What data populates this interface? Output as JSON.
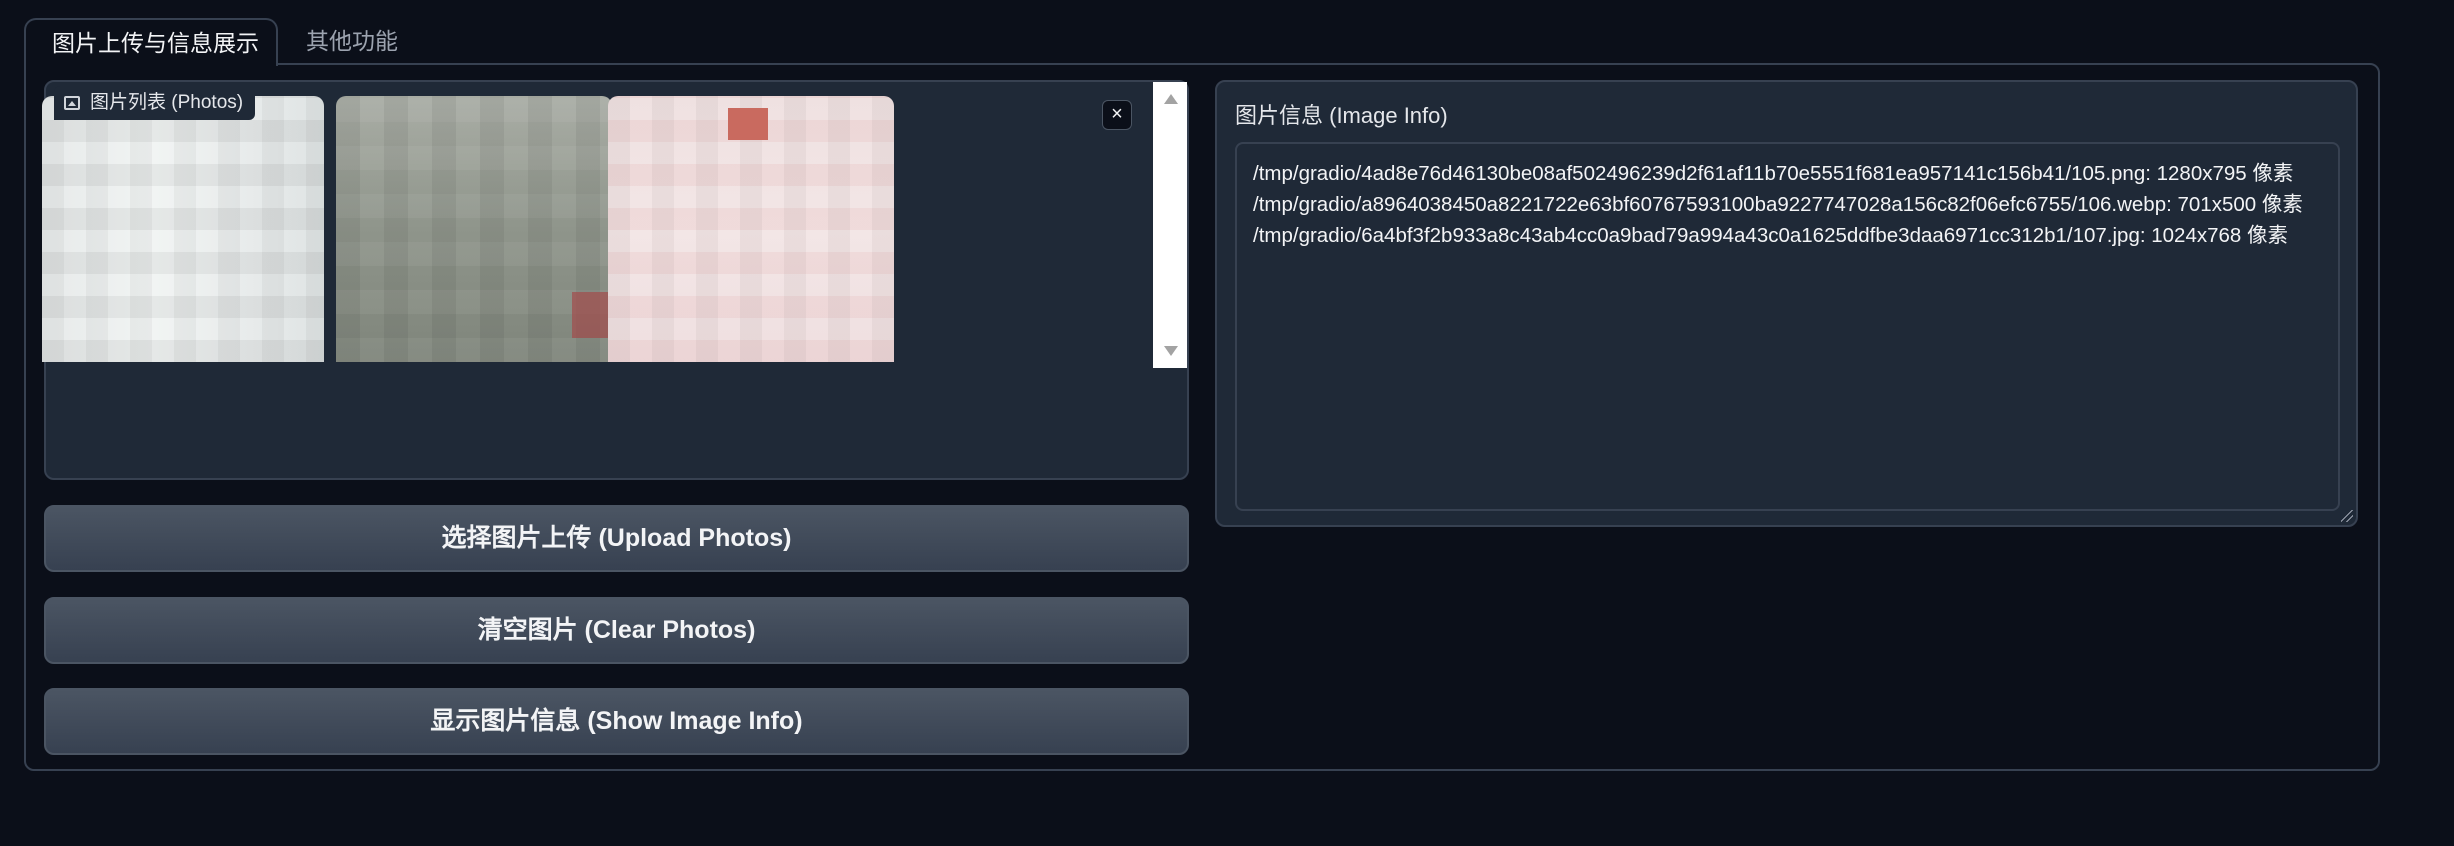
{
  "tabs": [
    {
      "label": "图片上传与信息展示",
      "active": true
    },
    {
      "label": "其他功能",
      "active": false
    }
  ],
  "gallery": {
    "label": "图片列表 (Photos)",
    "image_count": 3
  },
  "buttons": {
    "upload": "选择图片上传 (Upload Photos)",
    "clear": "清空图片 (Clear Photos)",
    "show_info": "显示图片信息 (Show Image Info)"
  },
  "info": {
    "label": "图片信息 (Image Info)",
    "text": "/tmp/gradio/4ad8e76d46130be08af502496239d2f61af11b70e5551f681ea957141c156b41/105.png: 1280x795 像素\n/tmp/gradio/a8964038450a8221722e63bf60767593100ba9227747028a156c82f06efc6755/106.webp: 701x500 像素\n/tmp/gradio/6a4bf3f2b933a8c43ab4cc0a9bad79a994a43c0a1625ddfbe3daa6971cc312b1/107.jpg: 1024x768 像素"
  },
  "colors": {
    "background": "#0b0f19",
    "panel": "#1f2937",
    "border": "#374151",
    "button": "#4b5563"
  },
  "icons": {
    "gallery_label": "image-icon",
    "close": "close-icon"
  }
}
